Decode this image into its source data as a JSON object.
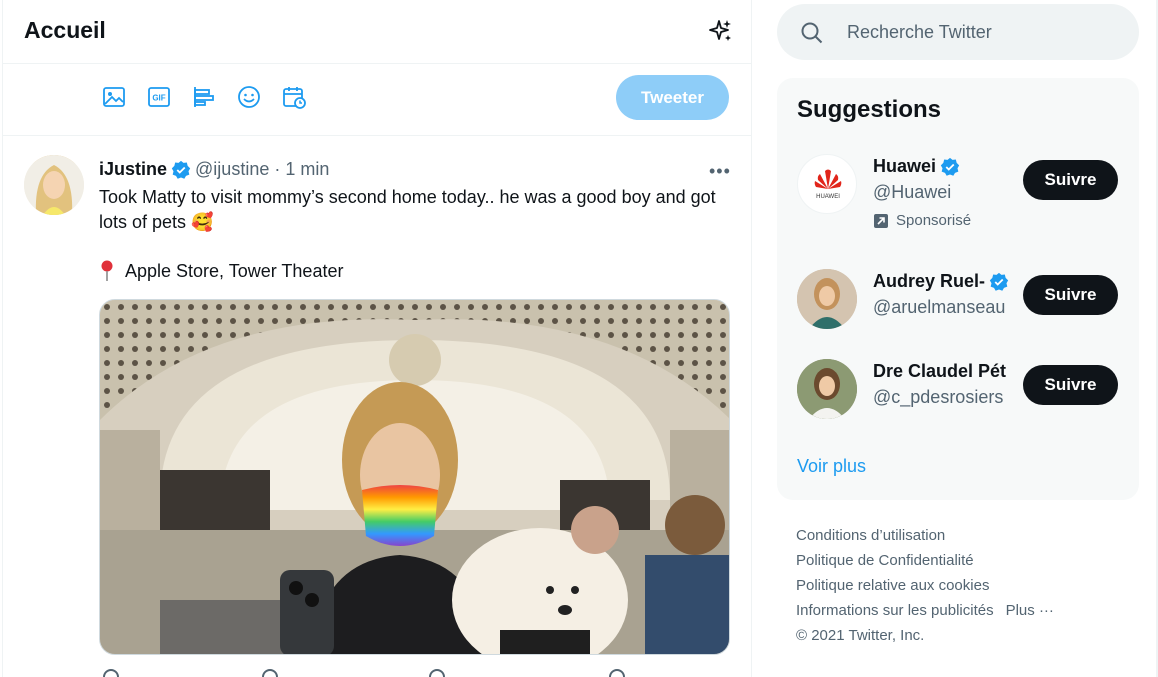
{
  "header": {
    "title": "Accueil",
    "sparkle_icon": "sparkle-icon"
  },
  "composer": {
    "tools": [
      "image-icon",
      "gif-icon",
      "poll-icon",
      "emoji-icon",
      "schedule-icon"
    ],
    "gif_label": "GIF",
    "tweet_label": "Tweeter"
  },
  "tweet": {
    "name": "iJustine",
    "handle": "@ijustine",
    "separator": "·",
    "time": "1 min",
    "more": "•••",
    "text": "Took Matty to visit mommy’s second home today.. he was a good boy and got lots of pets 🥰",
    "location": "Apple Store, Tower Theater"
  },
  "search": {
    "placeholder": "Recherche Twitter"
  },
  "suggestions": {
    "title": "Suggestions",
    "follow_label": "Suivre",
    "items": [
      {
        "name": "Huawei",
        "handle": "@Huawei",
        "promo": "Sponsorisé"
      },
      {
        "name": "Audrey Ruel-",
        "handle": "@aruelmanseau"
      },
      {
        "name": "Dre Claudel Pét",
        "handle": "@c_pdesrosiers"
      }
    ],
    "more_label": "Voir plus"
  },
  "footer": {
    "links": [
      "Conditions d’utilisation",
      "Politique de Confidentialité",
      "Politique relative aux cookies",
      "Informations sur les publicités"
    ],
    "more": "Plus ···",
    "copyright": "© 2021 Twitter, Inc."
  },
  "colors": {
    "accent": "#1d9bf0",
    "tweet_button_disabled": "#8ecdf8",
    "follow_button": "#0f1419"
  }
}
